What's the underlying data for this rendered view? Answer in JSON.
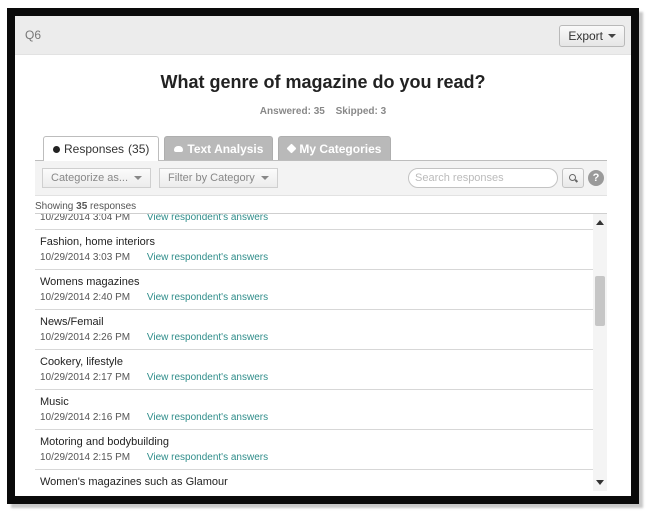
{
  "header": {
    "question_label": "Q6",
    "export_label": "Export"
  },
  "question": {
    "title": "What genre of magazine do you read?",
    "answered": "Answered: 35",
    "skipped": "Skipped: 3"
  },
  "tabs": [
    {
      "label": "Responses",
      "count": "(35)"
    },
    {
      "label": "Text Analysis"
    },
    {
      "label": "My Categories"
    }
  ],
  "toolbar": {
    "categorize_label": "Categorize as...",
    "filter_label": "Filter by Category",
    "search_placeholder": "Search responses",
    "help_label": "?"
  },
  "showing": {
    "prefix": "Showing",
    "count": "35",
    "suffix": "responses"
  },
  "link_label": "View respondent's answers",
  "responses": [
    {
      "text": "",
      "date": "10/29/2014 3:04 PM"
    },
    {
      "text": "Fashion, home interiors",
      "date": "10/29/2014 3:03 PM"
    },
    {
      "text": "Womens magazines",
      "date": "10/29/2014 2:40 PM"
    },
    {
      "text": "News/Femail",
      "date": "10/29/2014 2:26 PM"
    },
    {
      "text": "Cookery, lifestyle",
      "date": "10/29/2014 2:17 PM"
    },
    {
      "text": "Music",
      "date": "10/29/2014 2:16 PM"
    },
    {
      "text": "Motoring and bodybuilding",
      "date": "10/29/2014 2:15 PM"
    },
    {
      "text": "Women's magazines such as Glamour",
      "date": ""
    }
  ],
  "icons": {
    "export": "chevron-down-icon",
    "search": "search-icon",
    "help": "help-icon"
  },
  "colors": {
    "link": "#2f8d8a",
    "inactive_tab": "#b9b9b9"
  }
}
